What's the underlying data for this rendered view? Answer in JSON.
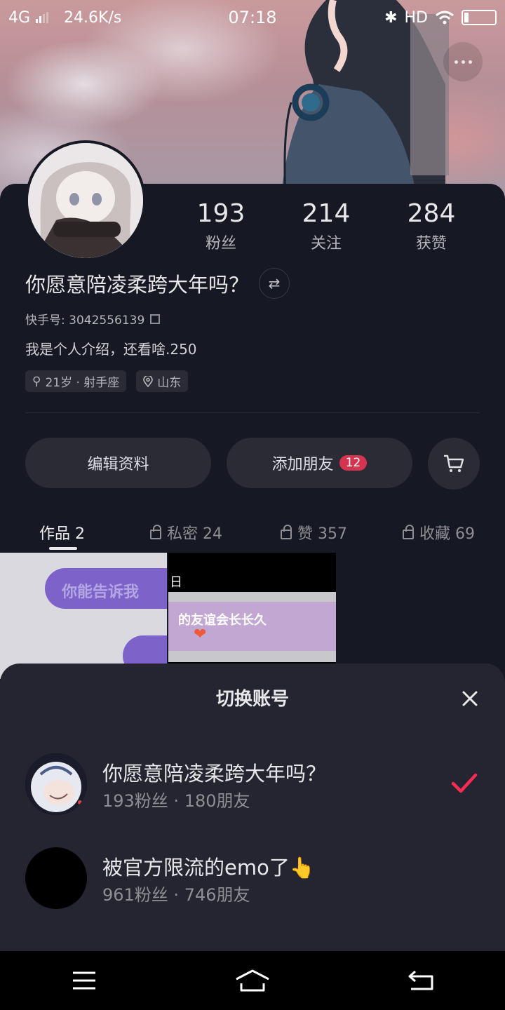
{
  "status_bar": {
    "network": "4G",
    "speed": "24.6K/s",
    "time": "07:18",
    "hd": "HD"
  },
  "profile": {
    "stats": [
      {
        "value": "193",
        "label": "粉丝"
      },
      {
        "value": "214",
        "label": "关注"
      },
      {
        "value": "284",
        "label": "获赞"
      }
    ],
    "name": "你愿意陪凌柔跨大年吗？",
    "uid": "快手号: 3042556139",
    "bio": "我是个人介绍，还看啥.250",
    "tags": [
      {
        "icon": "gender-icon",
        "text": "21岁 · 射手座"
      },
      {
        "icon": "location-icon",
        "text": "山东"
      }
    ],
    "edit_button": "编辑资料",
    "add_friend_button": "添加朋友",
    "add_friend_badge": "12"
  },
  "tabs": [
    {
      "label": "作品 2",
      "locked": false,
      "active": true
    },
    {
      "label": "私密 24",
      "locked": true,
      "active": false
    },
    {
      "label": "赞 357",
      "locked": true,
      "active": false
    },
    {
      "label": "收藏 69",
      "locked": true,
      "active": false
    }
  ],
  "thumbnails": {
    "t1_text": "你能告诉我",
    "t2_header": "日",
    "t2_line": "的友谊会长长久"
  },
  "sheet": {
    "title": "切换账号",
    "accounts": [
      {
        "name": "你愿意陪凌柔跨大年吗？",
        "sub": "193粉丝 · 180朋友",
        "selected": true
      },
      {
        "name": "被官方限流的emo了👆",
        "sub": "961粉丝 · 746朋友",
        "selected": false
      }
    ]
  },
  "colors": {
    "accent": "#fe2c55",
    "badge": "#d4344f",
    "panel": "#161823",
    "sheet": "#242530"
  }
}
